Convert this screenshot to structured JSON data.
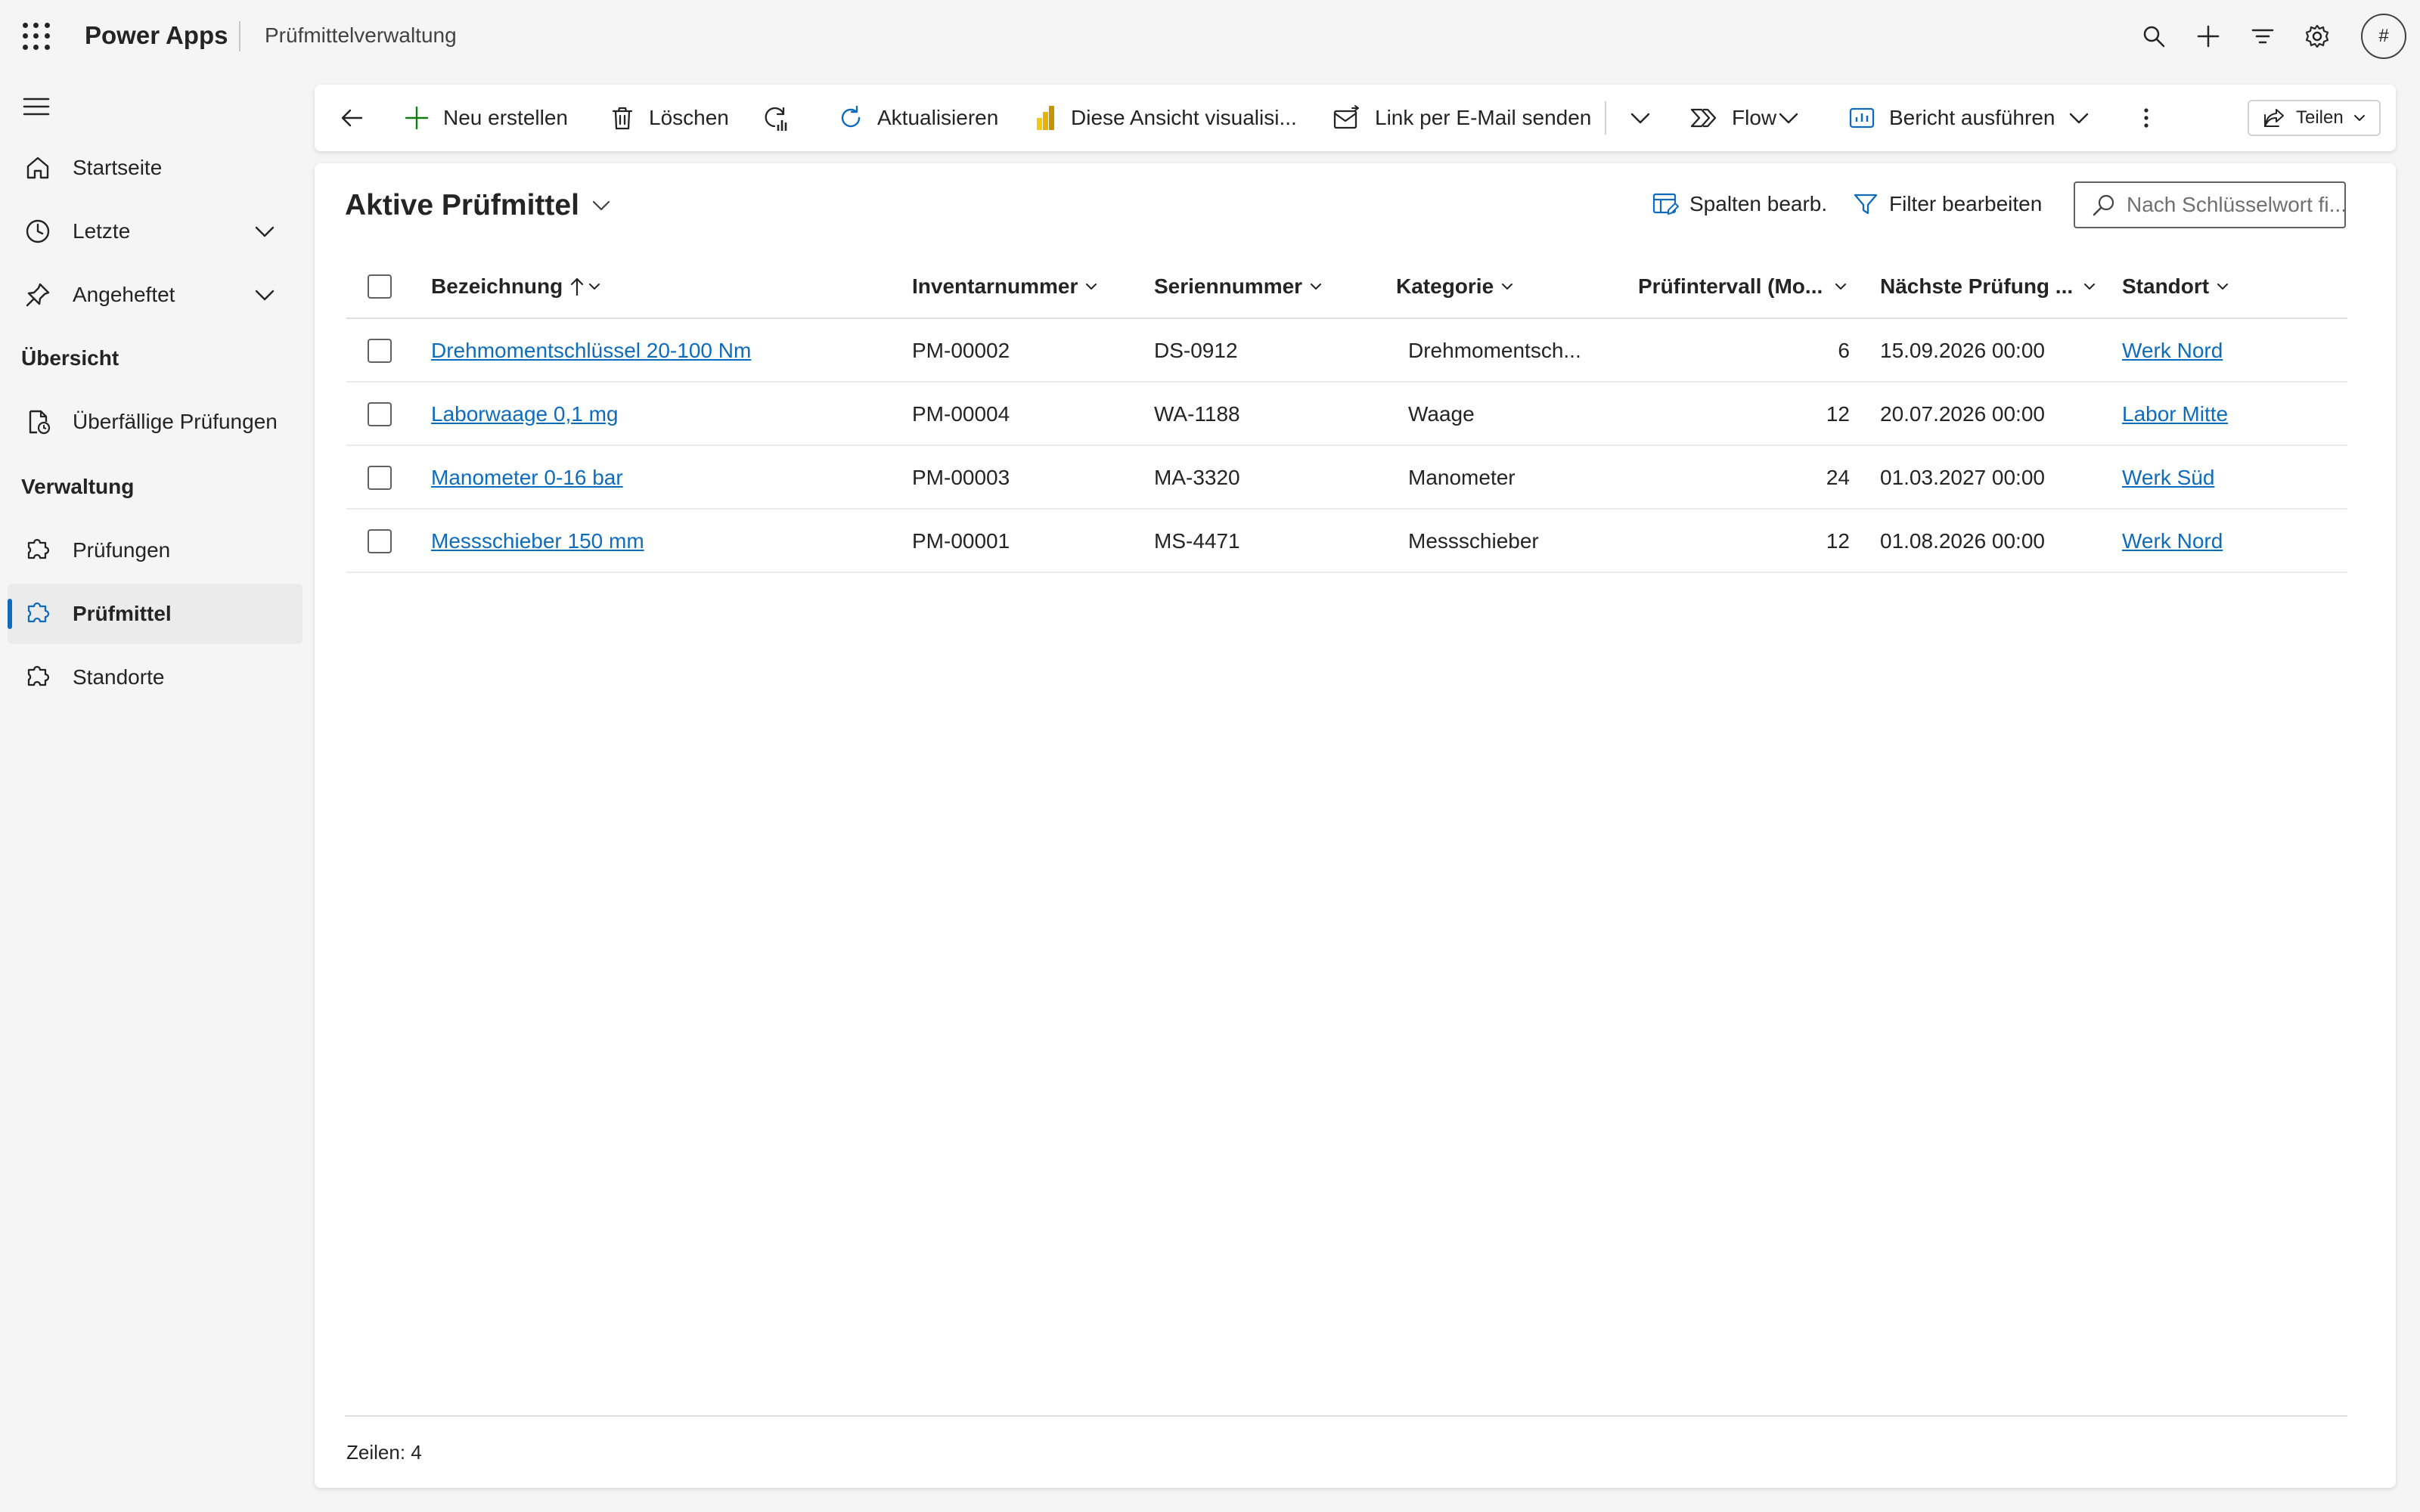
{
  "header": {
    "brand": "Power Apps",
    "app_name": "Prüfmittelverwaltung",
    "avatar_label": "#"
  },
  "sidebar": {
    "items": [
      {
        "label": "Startseite",
        "icon": "home-icon"
      },
      {
        "label": "Letzte",
        "icon": "clock-icon",
        "expandable": true
      },
      {
        "label": "Angeheftet",
        "icon": "pin-icon",
        "expandable": true
      }
    ],
    "sections": [
      {
        "title": "Übersicht",
        "items": [
          {
            "label": "Überfällige Prüfungen",
            "icon": "overdue-doc-icon"
          }
        ]
      },
      {
        "title": "Verwaltung",
        "items": [
          {
            "label": "Prüfungen",
            "icon": "puzzle-icon"
          },
          {
            "label": "Prüfmittel",
            "icon": "puzzle-icon",
            "active": true
          },
          {
            "label": "Standorte",
            "icon": "puzzle-icon"
          }
        ]
      }
    ]
  },
  "commandbar": {
    "new": "Neu erstellen",
    "delete": "Löschen",
    "refresh": "Aktualisieren",
    "visualize": "Diese Ansicht visualisi...",
    "email_link": "Link per E-Mail senden",
    "flow": "Flow",
    "report": "Bericht ausführen",
    "share": "Teilen"
  },
  "view": {
    "title": "Aktive Prüfmittel",
    "edit_columns": "Spalten bearb.",
    "edit_filters": "Filter bearbeiten",
    "search_placeholder": "Nach Schlüsselwort fi..."
  },
  "grid": {
    "columns": [
      "Bezeichnung",
      "Inventarnummer",
      "Seriennummer",
      "Kategorie",
      "Prüfintervall (Mo...",
      "Nächste Prüfung ...",
      "Standort"
    ],
    "rows": [
      {
        "name": "Drehmomentschlüssel 20-100 Nm",
        "inventory": "PM-00002",
        "serial": "DS-0912",
        "category": "Drehmomentsch...",
        "interval": "6",
        "next": "15.09.2026 00:00",
        "location": "Werk Nord"
      },
      {
        "name": "Laborwaage 0,1 mg",
        "inventory": "PM-00004",
        "serial": "WA-1188",
        "category": "Waage",
        "interval": "12",
        "next": "20.07.2026 00:00",
        "location": "Labor Mitte"
      },
      {
        "name": "Manometer 0-16 bar",
        "inventory": "PM-00003",
        "serial": "MA-3320",
        "category": "Manometer",
        "interval": "24",
        "next": "01.03.2027 00:00",
        "location": "Werk Süd"
      },
      {
        "name": "Messschieber 150 mm",
        "inventory": "PM-00001",
        "serial": "MS-4471",
        "category": "Messschieber",
        "interval": "12",
        "next": "01.08.2026 00:00",
        "location": "Werk Nord"
      }
    ],
    "footer": "Zeilen: 4"
  },
  "colors": {
    "accent": "#0f6cbd",
    "background": "#f5f5f5",
    "surface": "#ffffff",
    "text": "#242424"
  }
}
